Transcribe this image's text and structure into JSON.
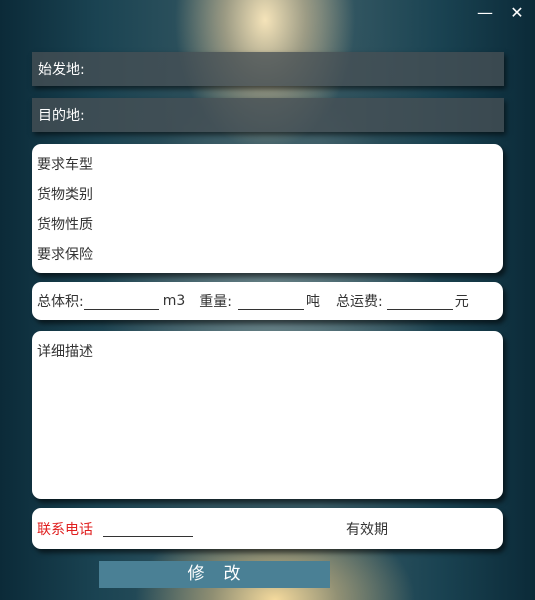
{
  "window_controls": {
    "minimize": "—",
    "close": "✕"
  },
  "origin": {
    "label": "始发地:",
    "value": ""
  },
  "destination": {
    "label": "目的地:",
    "value": ""
  },
  "options": {
    "vehicle_type": "要求车型",
    "cargo_category": "货物类别",
    "cargo_nature": "货物性质",
    "insurance": "要求保险"
  },
  "metrics": {
    "volume_label": "总体积:",
    "volume_value": "",
    "volume_unit": "m3",
    "weight_label": "重量:",
    "weight_value": "",
    "weight_unit": "吨",
    "fee_label": "总运费:",
    "fee_value": "",
    "fee_unit": "元"
  },
  "description": {
    "placeholder": "详细描述"
  },
  "contact": {
    "phone_label": "联系电话",
    "phone_value": "",
    "validity_label": "有效期"
  },
  "submit": {
    "label": "修　改"
  },
  "colors": {
    "accent_red": "#e02020",
    "button": "#4a8095"
  }
}
